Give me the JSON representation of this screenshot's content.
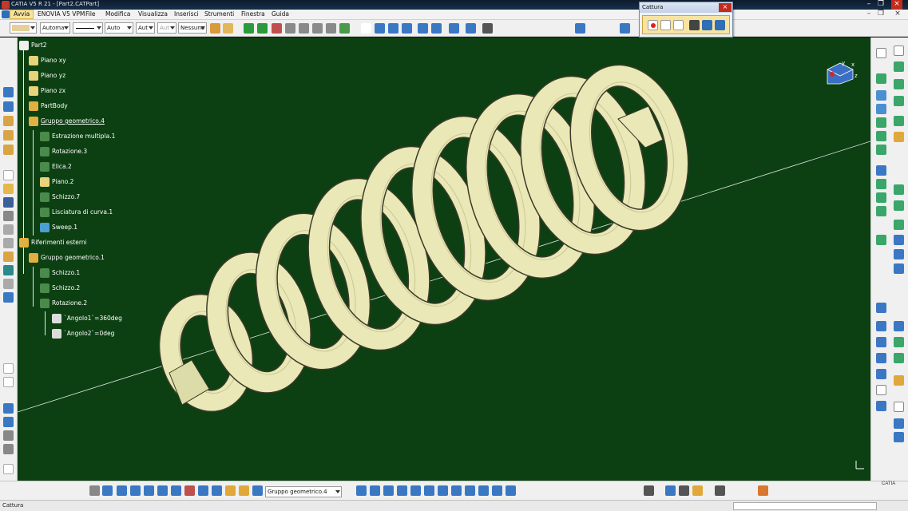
{
  "window": {
    "title": "CATIA V5 R 21 - [Part2.CATPart]"
  },
  "menu": {
    "items": [
      "Avvia",
      "ENOVIA V5 VPM",
      "File",
      "Modifica",
      "Visualizza",
      "Inserisci",
      "Strumenti",
      "Finestra",
      "Guida"
    ],
    "active_index": 0
  },
  "toolbar": {
    "layer_select": "Automa",
    "line_thickness": "Auto",
    "line_type": "Aut",
    "point_type": "Aut",
    "material_select": "Nessuno"
  },
  "cattura": {
    "title": "Cattura"
  },
  "tree": {
    "nodes": [
      {
        "label": "Part2",
        "icon": "part-icon",
        "underline": false
      },
      {
        "label": "Piano xy",
        "icon": "plane-icon",
        "underline": false
      },
      {
        "label": "Piano yz",
        "icon": "plane-icon",
        "underline": false
      },
      {
        "label": "Piano zx",
        "icon": "plane-icon",
        "underline": false
      },
      {
        "label": "PartBody",
        "icon": "gear-body-icon",
        "underline": false
      },
      {
        "label": "Gruppo geometrico.4",
        "icon": "geometric-set-icon",
        "underline": true
      },
      {
        "label": "Estrazione multipla.1",
        "icon": "extract-icon",
        "underline": false
      },
      {
        "label": "Rotazione.3",
        "icon": "rotation-icon",
        "underline": false
      },
      {
        "label": "Elica.2",
        "icon": "helix-icon",
        "underline": false
      },
      {
        "label": "Piano.2",
        "icon": "plane-icon",
        "underline": false
      },
      {
        "label": "Schizzo.7",
        "icon": "sketch-icon",
        "underline": false
      },
      {
        "label": "Lisciatura di curva.1",
        "icon": "curve-smooth-icon",
        "underline": false
      },
      {
        "label": "Sweep.1",
        "icon": "sweep-icon",
        "underline": false
      },
      {
        "label": "Riferimenti esterni",
        "icon": "external-ref-icon",
        "underline": false
      },
      {
        "label": "Gruppo geometrico.1",
        "icon": "geometric-set-icon",
        "underline": false
      },
      {
        "label": "Schizzo.1",
        "icon": "sketch-icon",
        "underline": false
      },
      {
        "label": "Schizzo.2",
        "icon": "sketch-icon",
        "underline": false
      },
      {
        "label": "Rotazione.2",
        "icon": "rotation-icon",
        "underline": false
      },
      {
        "label": "`Angolo1`=360deg",
        "icon": "parameter-icon",
        "underline": false
      },
      {
        "label": "`Angolo2`=0deg",
        "icon": "parameter-icon",
        "underline": false
      }
    ]
  },
  "compass": {
    "axis_x": "x",
    "axis_y": "y",
    "axis_z": "z"
  },
  "bottom": {
    "geometric_set_select": "Gruppo geometrico.4"
  },
  "status": {
    "text": "Cattura"
  },
  "brand": {
    "logo": "CATIA"
  },
  "colors": {
    "viewport_bg": "#0c4012",
    "spring_fill": "#e9e8b6",
    "menu_active": "#f6e3a0"
  }
}
